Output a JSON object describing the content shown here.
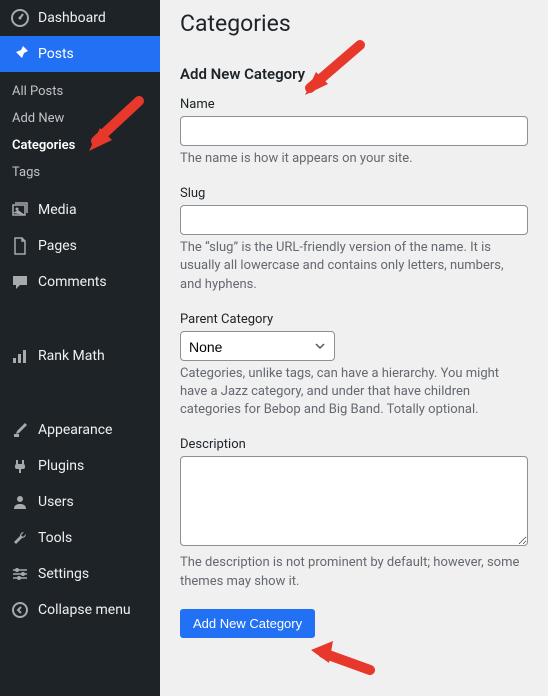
{
  "sidebar": {
    "dashboard": "Dashboard",
    "posts": "Posts",
    "posts_sub": {
      "all": "All Posts",
      "add_new": "Add New",
      "categories": "Categories",
      "tags": "Tags"
    },
    "media": "Media",
    "pages": "Pages",
    "comments": "Comments",
    "rank_math": "Rank Math",
    "appearance": "Appearance",
    "plugins": "Plugins",
    "users": "Users",
    "tools": "Tools",
    "settings": "Settings",
    "collapse": "Collapse menu"
  },
  "main": {
    "page_title": "Categories",
    "section_title": "Add New Category",
    "name": {
      "label": "Name",
      "value": "",
      "help": "The name is how it appears on your site."
    },
    "slug": {
      "label": "Slug",
      "value": "",
      "help": "The “slug” is the URL-friendly version of the name. It is usually all lowercase and contains only letters, numbers, and hyphens."
    },
    "parent": {
      "label": "Parent Category",
      "selected": "None",
      "help": "Categories, unlike tags, can have a hierarchy. You might have a Jazz category, and under that have children categories for Bebop and Big Band. Totally optional."
    },
    "description": {
      "label": "Description",
      "value": "",
      "help": "The description is not prominent by default; however, some themes may show it."
    },
    "submit": "Add New Category"
  }
}
